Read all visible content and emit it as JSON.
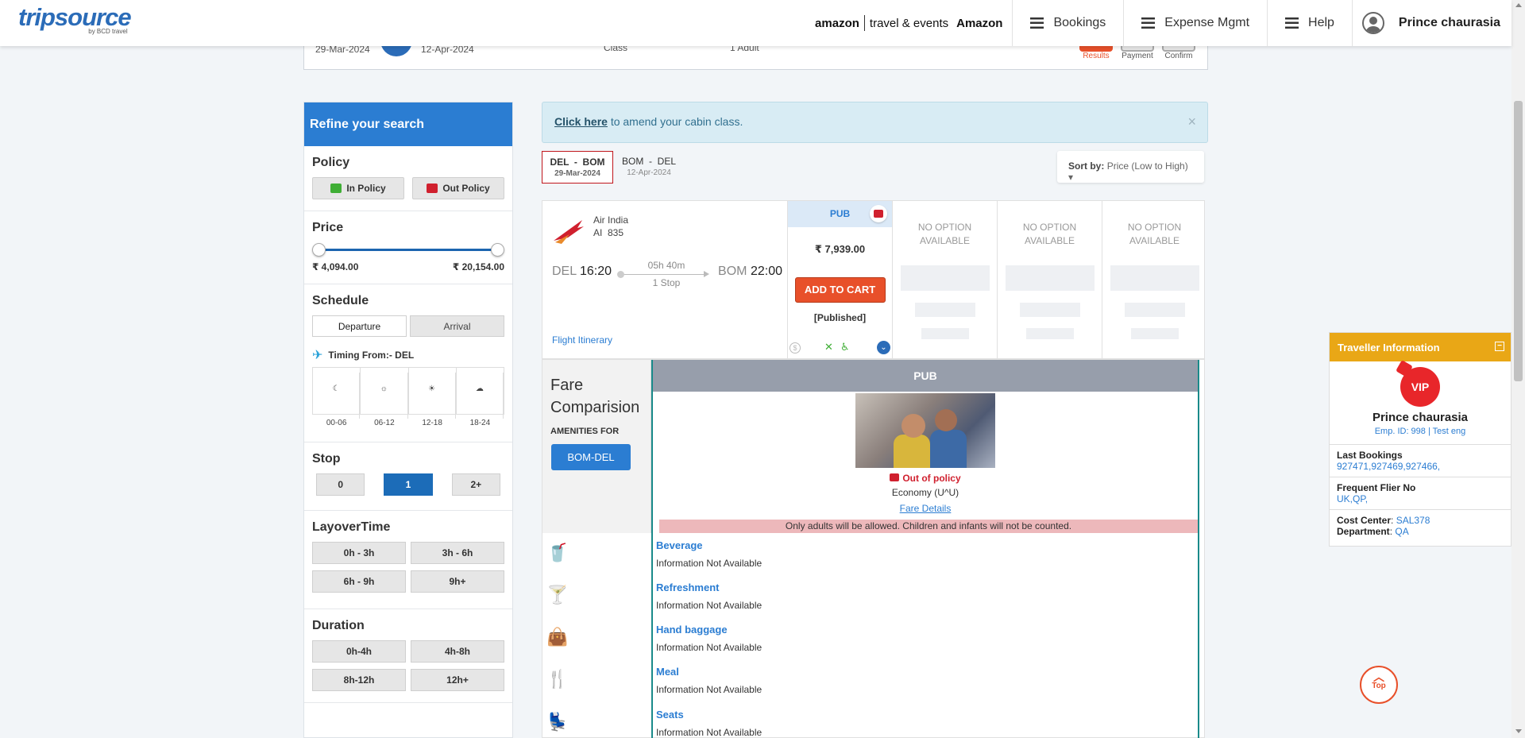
{
  "header": {
    "logo_main": "tripsource",
    "logo_sub": "by BCD travel",
    "amazon_logo": "amazon",
    "amazon_te": "travel & events",
    "amazon_name": "Amazon",
    "nav": [
      "Bookings",
      "Expense Mgmt",
      "Help"
    ],
    "user_name": "Prince chaurasia"
  },
  "summary": {
    "depart_date": "29-Mar-2024",
    "return_date": "12-Apr-2024",
    "class_label": "Class",
    "pax": "1 Adult",
    "steps": [
      "Results",
      "Payment",
      "Confirm"
    ]
  },
  "refine": {
    "title": "Refine your search",
    "policy": {
      "title": "Policy",
      "in": "In Policy",
      "out": "Out Policy"
    },
    "price": {
      "title": "Price",
      "min": "₹ 4,094.00",
      "max": "₹ 20,154.00"
    },
    "schedule": {
      "title": "Schedule",
      "departure": "Departure",
      "arrival": "Arrival",
      "timing": "Timing From:- DEL",
      "slots": [
        "00-06",
        "06-12",
        "12-18",
        "18-24"
      ]
    },
    "stop": {
      "title": "Stop",
      "options": [
        "0",
        "1",
        "2+"
      ],
      "selected": "1"
    },
    "layover": {
      "title": "LayoverTime",
      "options": [
        "0h - 3h",
        "3h - 6h",
        "6h - 9h",
        "9h+"
      ]
    },
    "duration": {
      "title": "Duration",
      "options": [
        "0h-4h",
        "4h-8h",
        "8h-12h",
        "12h+"
      ]
    }
  },
  "alert": {
    "link": "Click here",
    "text": " to amend your cabin class.",
    "close": "×"
  },
  "tabs": [
    {
      "route": "DEL  -  BOM",
      "date": "29-Mar-2024"
    },
    {
      "route": "BOM  -  DEL",
      "date": "12-Apr-2024"
    }
  ],
  "sort": {
    "label": "Sort by:",
    "value": "Price (Low to High)"
  },
  "flight": {
    "airline": "Air India",
    "number": "AI  835",
    "from_code": "DEL",
    "from_time": "16:20",
    "to_code": "BOM",
    "to_time": "22:00",
    "duration": "05h 40m",
    "stops": "1 Stop",
    "itinerary_link": "Flight Itinerary",
    "fare_class": "PUB",
    "fare": "₹ 7,939.00",
    "add_to_cart": "ADD TO CART",
    "fare_type": "[Published]",
    "no_option": "NO OPTION AVAILABLE"
  },
  "fare_comparison": {
    "title": "Fare Comparision",
    "amenities_for": "AMENITIES FOR",
    "route_btn": "BOM-DEL",
    "column": "PUB",
    "policy_status": "Out of policy",
    "cabin": "Economy (U^U)",
    "fare_details": "Fare Details",
    "notice": "Only adults will be allowed. Children and infants will not be counted.",
    "amenities": [
      {
        "name": "Beverage",
        "value": "Information Not Available",
        "icon": "beverage-icon"
      },
      {
        "name": "Refreshment",
        "value": "Information Not Available",
        "icon": "refreshment-icon"
      },
      {
        "name": "Hand baggage",
        "value": "Information Not Available",
        "icon": "baggage-icon"
      },
      {
        "name": "Meal",
        "value": "Information Not Available",
        "icon": "meal-icon"
      },
      {
        "name": "Seats",
        "value": "Information Not Available",
        "icon": "seat-icon"
      }
    ]
  },
  "traveller": {
    "title": "Traveller Information",
    "badge": "VIP",
    "name": "Prince chaurasia",
    "emp": "Emp. ID: 998 | Test eng",
    "last_bookings_label": "Last Bookings",
    "last_bookings": "927471,927469,927466,",
    "ffn_label": "Frequent Flier No",
    "ffn": "UK,QP,",
    "cost_center_label": "Cost Center",
    "cost_center": "SAL378",
    "department_label": "Department",
    "department": "QA"
  },
  "top_button": "Top",
  "colors": {
    "brand": "#2b7dd2",
    "accent": "#e8502a",
    "policy_bad": "#d0202e",
    "policy_good": "#3fae35",
    "traveller_header": "#e9a716"
  }
}
